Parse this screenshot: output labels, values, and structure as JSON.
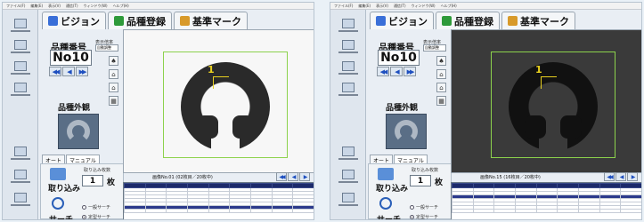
{
  "menu": [
    "ファイル(F)",
    "編集(E)",
    "表示(V)",
    "通信(T)",
    "ウィンドウ(W)",
    "ヘルプ(H)"
  ],
  "tabs": [
    {
      "label": "ビジョン",
      "icon": "camera-icon",
      "color": "#3a6fd8"
    },
    {
      "label": "品種登録",
      "icon": "register-icon",
      "color": "#2e9a3a"
    },
    {
      "label": "基準マーク",
      "icon": "mark-icon",
      "color": "#d89a2a"
    }
  ],
  "panels": [
    {
      "hinban_label": "品種番号",
      "product_no": "No10",
      "display_label": "表示倍率",
      "display_value": "自動調整",
      "gaikan_label": "品種外観",
      "mode_tabs": [
        "オート",
        "マニュアル"
      ],
      "count_label": "取り込み枚数",
      "count_value": "1",
      "count_unit": "枚",
      "torikomi_label": "取り込み",
      "search_label": "サーチ",
      "radio_labels": [
        "一般サーチ",
        "定型サーチ"
      ],
      "image_info": "画像No.01 (02枚目／20枚中)",
      "theme": "light"
    },
    {
      "hinban_label": "品種番号",
      "product_no": "No10",
      "display_label": "表示倍率",
      "display_value": "自動調整",
      "gaikan_label": "品種外観",
      "mode_tabs": [
        "オート",
        "マニュアル"
      ],
      "count_label": "取り込み枚数",
      "count_value": "1",
      "count_unit": "枚",
      "torikomi_label": "取り込み",
      "search_label": "サーチ",
      "radio_labels": [
        "一般サーチ",
        "定型サーチ"
      ],
      "image_info": "画像No.15 (16枚目／20枚中)",
      "theme": "dark"
    }
  ],
  "marker_label": "1",
  "colors": {
    "roi": "#8cd24c",
    "marker": "#e8d020",
    "grid_header": "#1c2a6a",
    "grid_selected": "#2c3a8c"
  }
}
